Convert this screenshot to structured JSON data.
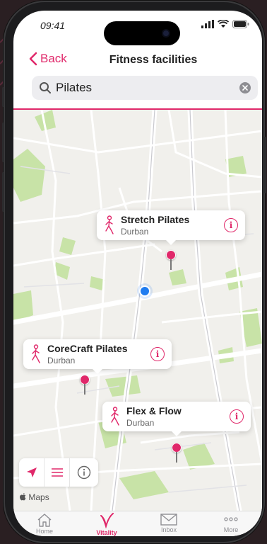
{
  "status": {
    "time": "09:41"
  },
  "nav": {
    "back_label": "Back",
    "title": "Fitness facilities"
  },
  "search": {
    "value": "Pilates"
  },
  "facilities": [
    {
      "name": "Stretch Pilates",
      "city": "Durban"
    },
    {
      "name": "CoreCraft Pilates",
      "city": "Durban"
    },
    {
      "name": "Flex & Flow",
      "city": "Durban"
    }
  ],
  "map": {
    "attribution": "Maps"
  },
  "tabs": [
    {
      "label": "Home",
      "icon": "home-icon"
    },
    {
      "label": "Vitality",
      "icon": "vitality-icon",
      "active": true
    },
    {
      "label": "Inbox",
      "icon": "inbox-icon"
    },
    {
      "label": "More",
      "icon": "more-icon"
    }
  ],
  "colors": {
    "accent": "#e0286a",
    "user_location": "#1f7cf0",
    "park": "#c8e3a7"
  }
}
